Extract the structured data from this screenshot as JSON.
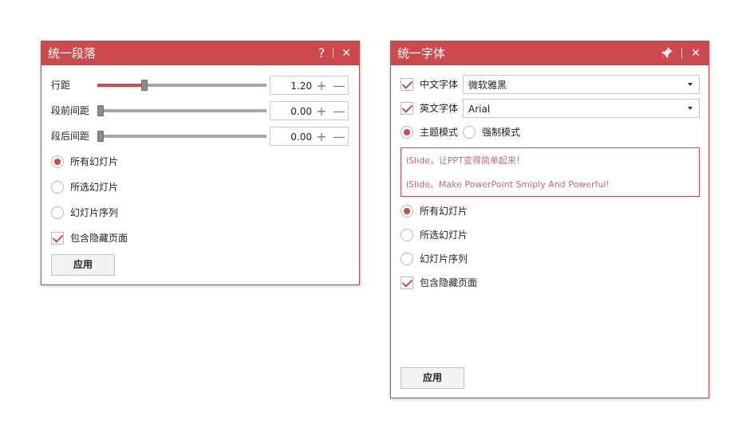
{
  "paragraph_panel": {
    "title": "统一段落",
    "help_label": "?",
    "close_label": "✕",
    "rows": [
      {
        "label": "行距",
        "value": "1.20",
        "fill": 0.26
      },
      {
        "label": "段前间距",
        "value": "0.00",
        "fill": 0.0
      },
      {
        "label": "段后间距",
        "value": "0.00",
        "fill": 0.0
      }
    ],
    "plus_label": "+",
    "minus_label": "—",
    "scope": [
      {
        "label": "所有幻灯片",
        "selected": true
      },
      {
        "label": "所选幻灯片",
        "selected": false
      },
      {
        "label": "幻灯片序列",
        "selected": false
      }
    ],
    "include_hidden": {
      "label": "包含隐藏页面",
      "checked": true
    },
    "apply_label": "应用"
  },
  "font_panel": {
    "title": "统一字体",
    "pin_icon": "pin-icon",
    "close_label": "✕",
    "chinese_font": {
      "label": "中文字体",
      "checked": true,
      "value": "微软雅黑"
    },
    "english_font": {
      "label": "英文字体",
      "checked": true,
      "value": "Arial"
    },
    "mode": [
      {
        "label": "主题模式",
        "selected": true
      },
      {
        "label": "强制模式",
        "selected": false
      }
    ],
    "preview": {
      "line1": "iSlide，让PPT变得简单起来！",
      "line2": "iSlide。Make PowerPoint Smiply And Powerful!"
    },
    "scope": [
      {
        "label": "所有幻灯片",
        "selected": true
      },
      {
        "label": "所选幻灯片",
        "selected": false
      },
      {
        "label": "幻灯片序列",
        "selected": false
      }
    ],
    "include_hidden": {
      "label": "包含隐藏页面",
      "checked": true
    },
    "apply_label": "应用"
  },
  "colors": {
    "accent": "#cc4a4d",
    "slider_track": "#a6a6a6"
  }
}
